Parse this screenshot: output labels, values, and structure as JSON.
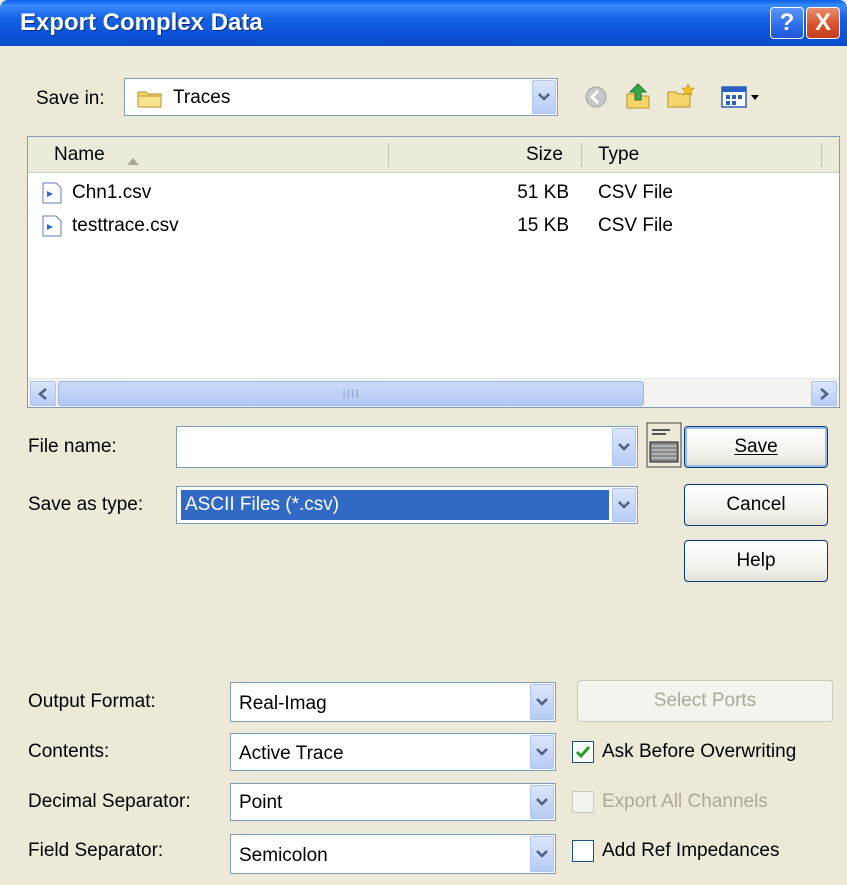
{
  "window": {
    "title": "Export Complex Data",
    "help_glyph": "?",
    "close_glyph": "X"
  },
  "save_in": {
    "label": "Save in:",
    "value": "Traces"
  },
  "file_list": {
    "columns": [
      "Name",
      "Size",
      "Type"
    ],
    "rows": [
      {
        "name": "Chn1.csv",
        "size": "51 KB",
        "type": "CSV File"
      },
      {
        "name": "testtrace.csv",
        "size": "15 KB",
        "type": "CSV File"
      }
    ],
    "scroll_grip": "IIII"
  },
  "file_name": {
    "label": "File name:",
    "value": ""
  },
  "save_as_type": {
    "label": "Save as type:",
    "value": "ASCII Files (*.csv)"
  },
  "buttons": {
    "save": "Save",
    "cancel": "Cancel",
    "help": "Help",
    "select_ports": "Select Ports"
  },
  "options": {
    "output_format": {
      "label": "Output Format:",
      "value": "Real-Imag"
    },
    "contents": {
      "label": "Contents:",
      "value": "Active Trace"
    },
    "decimal_separator": {
      "label": "Decimal Separator:",
      "value": "Point"
    },
    "field_separator": {
      "label": "Field Separator:",
      "value": "Semicolon"
    }
  },
  "checkboxes": {
    "ask_before_overwriting": {
      "label": "Ask Before Overwriting",
      "checked": true
    },
    "export_all_channels": {
      "label": "Export All Channels",
      "checked": false,
      "disabled": true
    },
    "add_ref_impedances": {
      "label": "Add Ref Impedances",
      "checked": false
    }
  },
  "colors": {
    "titlebar": "#0a5fe9",
    "selection": "#316ac5",
    "dialog_bg": "#ece9d8"
  }
}
